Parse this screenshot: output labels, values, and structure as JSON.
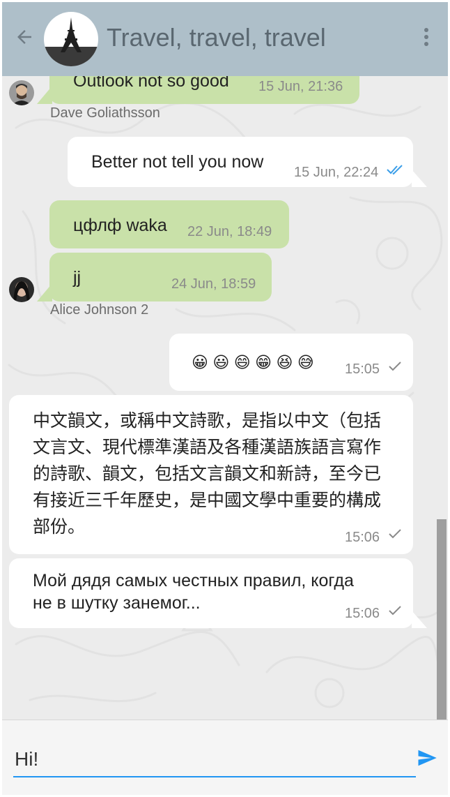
{
  "header": {
    "title": "Travel, travel, travel",
    "back_icon": "arrow-left-icon",
    "menu_icon": "more-vertical-icon",
    "avatar": "eiffel-tower-avatar"
  },
  "messages": [
    {
      "direction": "incoming",
      "text": "Outlook not so good",
      "time": "15 Jun, 21:36",
      "sender": "Dave Goliathsson"
    },
    {
      "direction": "outgoing",
      "text": "Better not tell you now",
      "time": "15 Jun, 22:24",
      "status": "read"
    },
    {
      "direction": "incoming",
      "text": "цфлф waka",
      "time": "22 Jun, 18:49"
    },
    {
      "direction": "incoming",
      "text": "jj",
      "time": "24 Jun, 18:59",
      "sender": "Alice Johnson 2"
    },
    {
      "direction": "outgoing",
      "text": "😀 😃 😄 😁 😆 😅",
      "time": "15:05",
      "status": "sent"
    },
    {
      "direction": "outgoing",
      "text": "中文韻文，或稱中文詩歌，是指以中文（包括文言文、現代標準漢語及各種漢語族語言寫作的詩歌、韻文，包括文言韻文和新詩，至今已有接近三千年歷史，是中國文學中重要的構成部份。",
      "lines": [
        "中文韻文，或稱中文詩歌，是指以中文（包括",
        "文言文、現代標準漢語及各種漢語族語言寫作",
        "的詩歌、韻文，包括文言韻文和新詩，至今已",
        "有接近三千年歷史，是中國文學中重要的構成",
        "部份。"
      ],
      "time": "15:06",
      "status": "sent"
    },
    {
      "direction": "outgoing",
      "text": "Мой дядя самых честных правил, когда не в шутку занемог...",
      "lines": [
        "Мой дядя самых честных правил, когда",
        "не в шутку занемог..."
      ],
      "time": "15:06",
      "status": "sent"
    }
  ],
  "composer": {
    "value": "Hi!",
    "send_icon": "send-icon"
  },
  "colors": {
    "appbar": "#aebfc9",
    "incoming_bubble": "#c9e1a9",
    "outgoing_bubble": "#ffffff",
    "accent": "#2196f3",
    "background": "#ececec"
  }
}
